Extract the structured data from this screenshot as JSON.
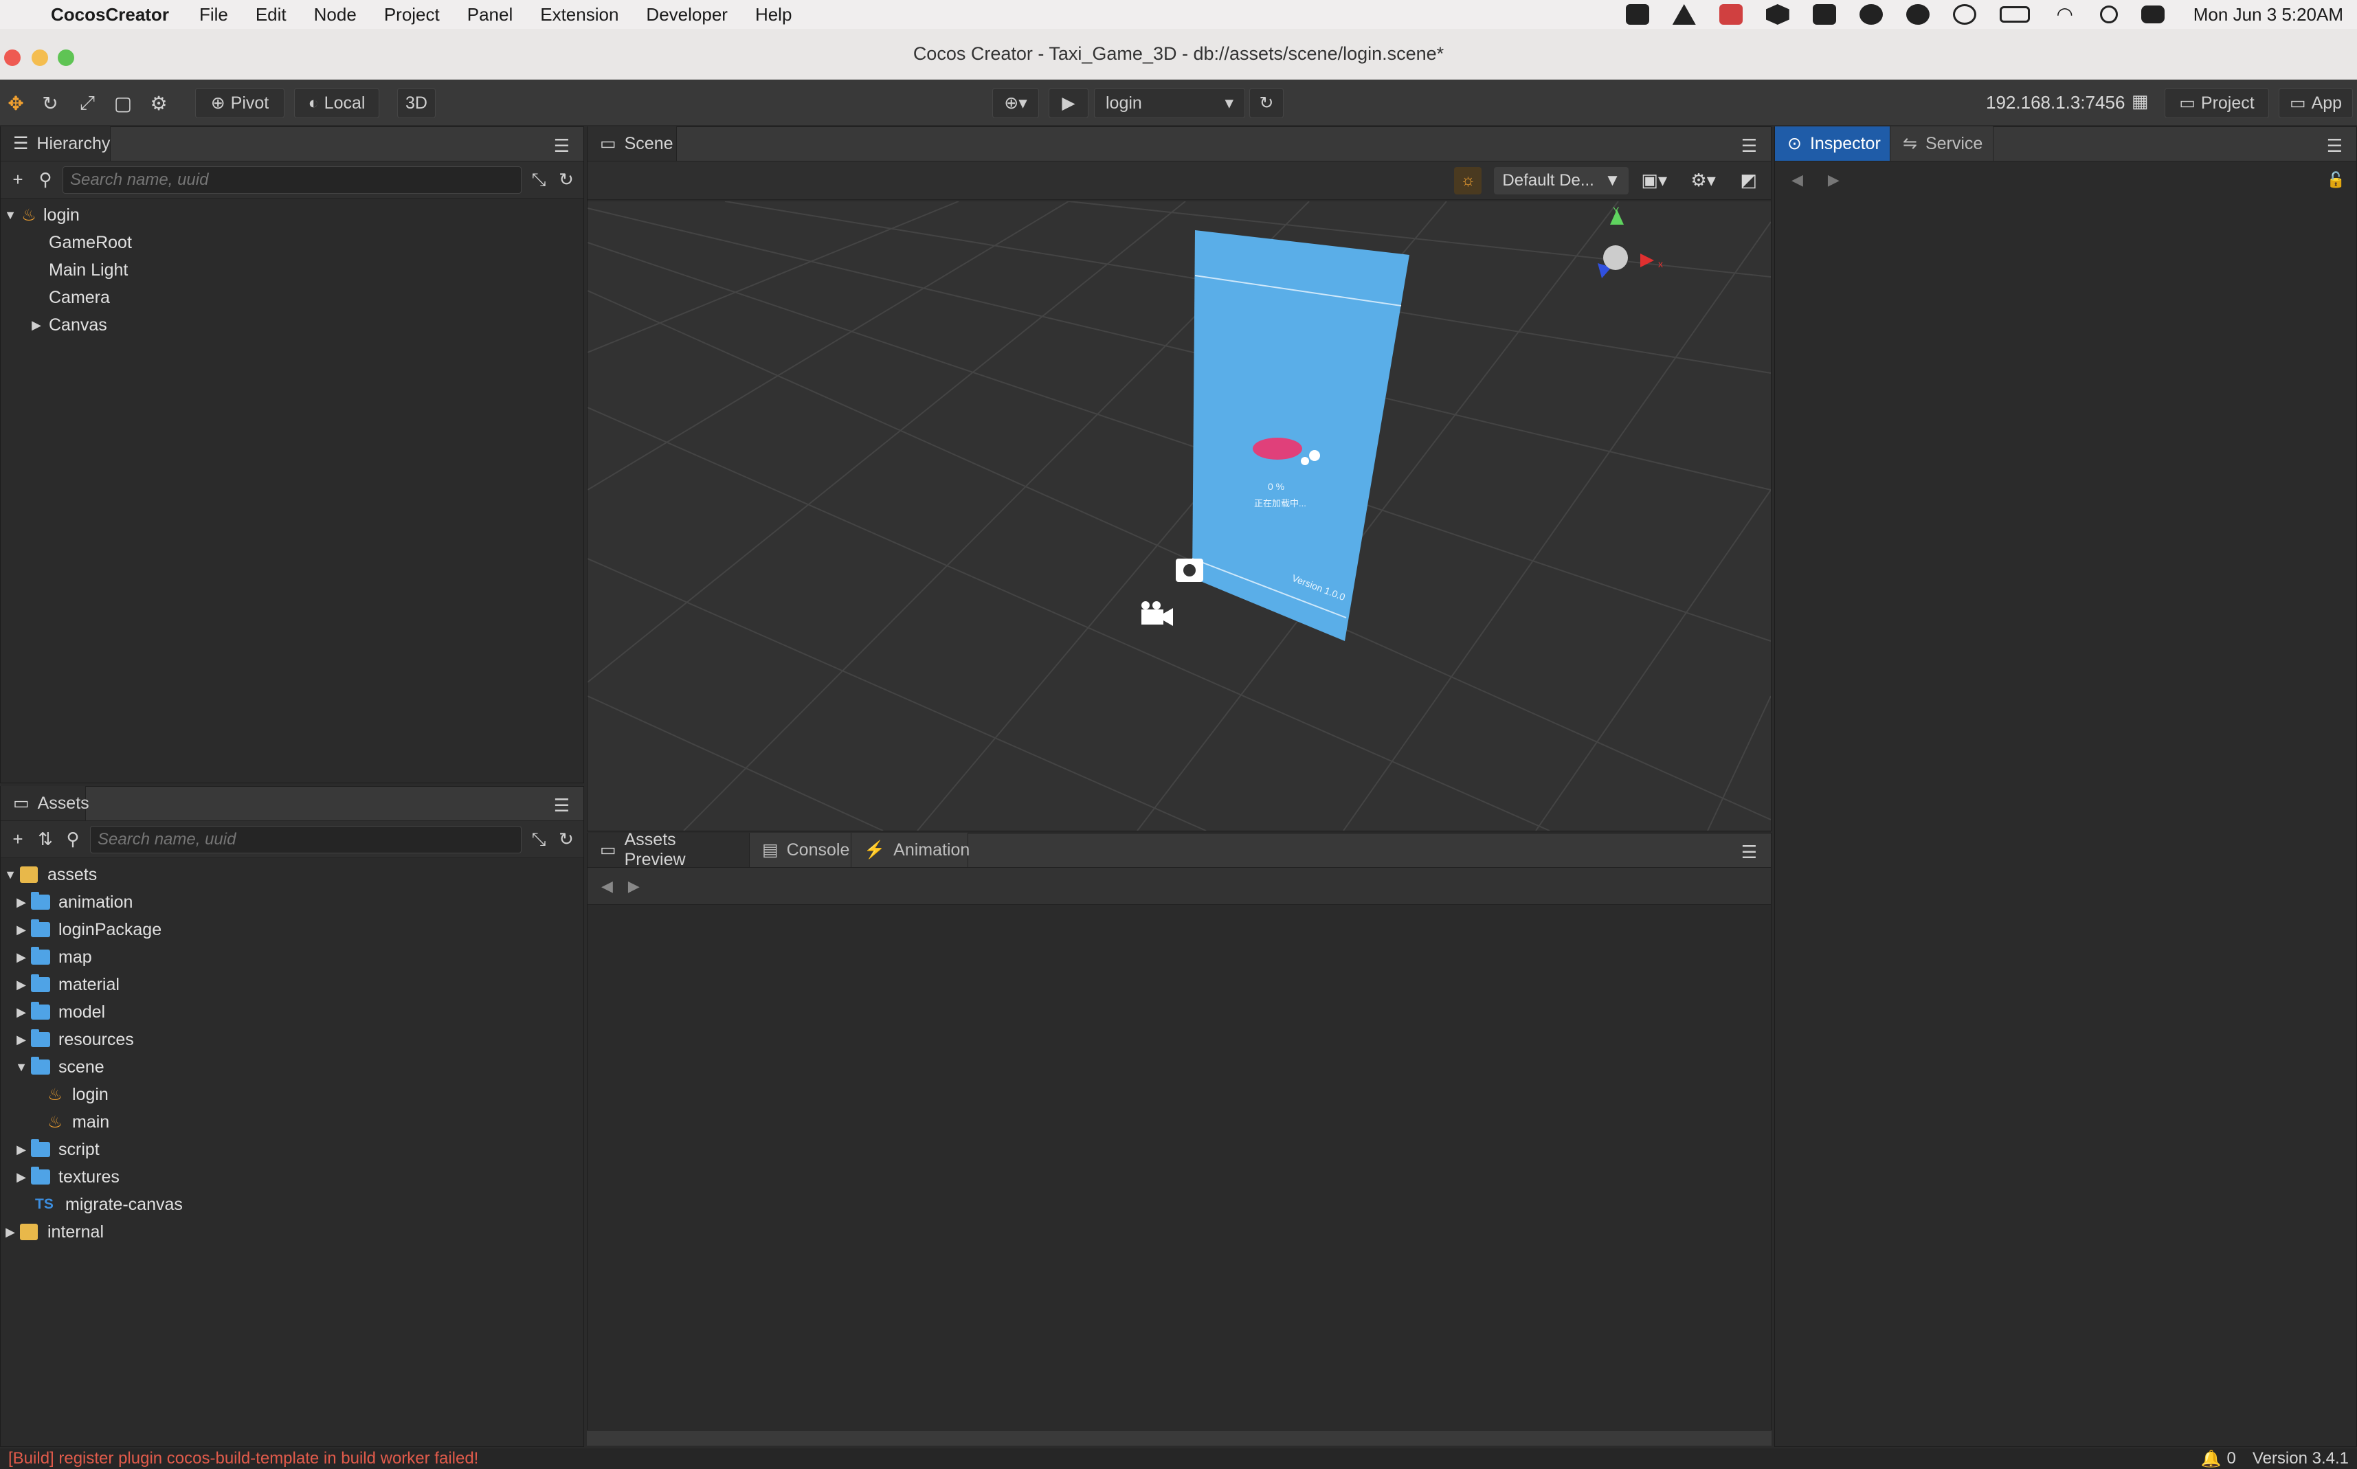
{
  "menubar": {
    "app_name": "CocosCreator",
    "items": [
      "File",
      "Edit",
      "Node",
      "Project",
      "Panel",
      "Extension",
      "Developer",
      "Help"
    ],
    "clock": "Mon Jun 3  5:20AM"
  },
  "window": {
    "title": "Cocos Creator - Taxi_Game_3D - db://assets/scene/login.scene*"
  },
  "toolbar": {
    "pivot": "Pivot",
    "local": "Local",
    "mode_3d": "3D",
    "scene_select": "login",
    "ip": "192.168.1.3:7456",
    "project_btn": "Project",
    "app_btn": "App"
  },
  "hierarchy": {
    "title": "Hierarchy",
    "search_placeholder": "Search name, uuid",
    "root": "login",
    "children": [
      "GameRoot",
      "Main Light",
      "Camera",
      "Canvas"
    ]
  },
  "assets": {
    "title": "Assets",
    "search_placeholder": "Search name, uuid",
    "root": "assets",
    "folders": [
      "animation",
      "loginPackage",
      "map",
      "material",
      "model",
      "resources",
      "scene"
    ],
    "scene_children": [
      "login",
      "main"
    ],
    "folders_after": [
      "script",
      "textures"
    ],
    "ts_file": "migrate-canvas",
    "internal": "internal"
  },
  "scene": {
    "tab": "Scene",
    "render_mode": "Default De...",
    "preview_percent": "0 %",
    "preview_loading": "正在加载中...",
    "preview_version": "Version 1.0.0"
  },
  "bottom": {
    "tabs": [
      "Assets Preview",
      "Console",
      "Animation"
    ]
  },
  "inspector": {
    "tabs": [
      "Inspector",
      "Service"
    ]
  },
  "status": {
    "error": "[Build] register plugin cocos-build-template in build worker failed!",
    "count": "0",
    "version": "Version 3.4.1"
  },
  "colors": {
    "accent": "#1f5ca8",
    "error": "#e25b4b",
    "folder": "#4fa3e6"
  }
}
